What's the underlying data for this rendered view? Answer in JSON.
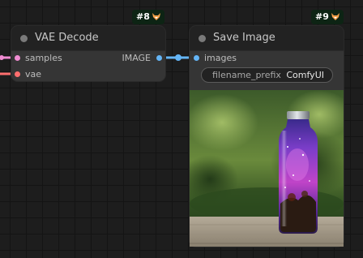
{
  "nodes": {
    "vae_decode": {
      "badge": "#8",
      "title": "VAE Decode",
      "inputs": [
        {
          "label": "samples",
          "color": "#f08cd2"
        },
        {
          "label": "vae",
          "color": "#ff6e6e"
        }
      ],
      "output": {
        "label": "IMAGE",
        "color": "#64b5f6"
      }
    },
    "save_image": {
      "badge": "#9",
      "title": "Save Image",
      "input": {
        "label": "images",
        "color": "#64b5f6"
      },
      "widget": {
        "name": "filename_prefix",
        "value": "ComfyUI"
      },
      "preview_icon": "galaxy-bottle-photo"
    }
  },
  "icons": {
    "badge_icon": "fox-icon",
    "title_dot": "circle-icon"
  },
  "colors": {
    "node_body": "#353535",
    "node_header": "#222222",
    "canvas": "#1d1d1d",
    "badge_bg": "#0d2414"
  }
}
